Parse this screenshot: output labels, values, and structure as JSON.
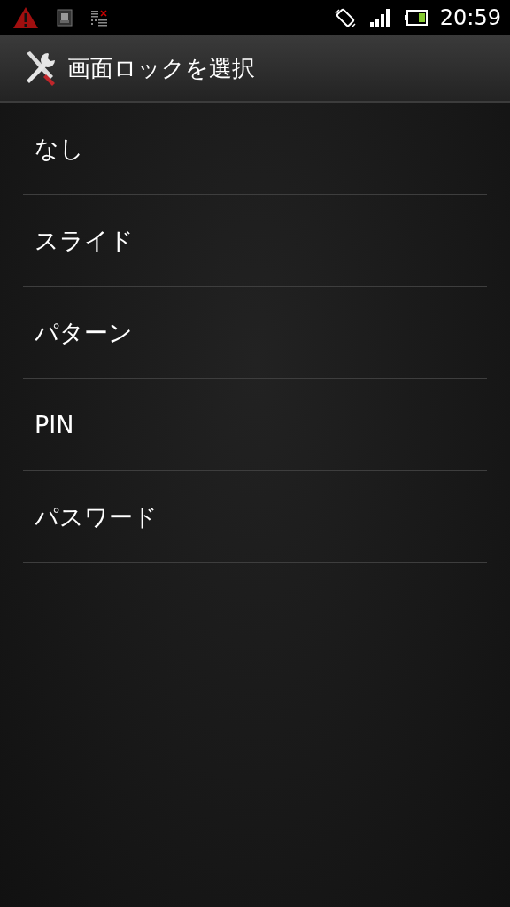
{
  "status_bar": {
    "time": "20:59"
  },
  "title": "画面ロックを選択",
  "options": [
    {
      "label": "なし"
    },
    {
      "label": "スライド"
    },
    {
      "label": "パターン"
    },
    {
      "label": "PIN"
    },
    {
      "label": "パスワード"
    }
  ]
}
